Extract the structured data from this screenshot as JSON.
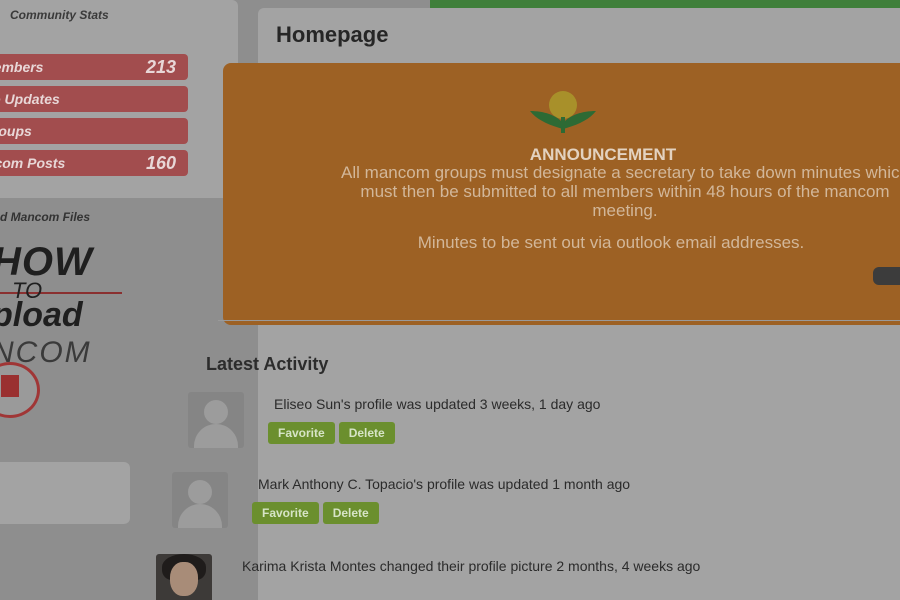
{
  "community_stats": {
    "title": "Community Stats",
    "items": [
      {
        "label": "Members",
        "value": "213"
      },
      {
        "label": "No Updates",
        "value": ""
      },
      {
        "label": "Groups",
        "value": ""
      },
      {
        "label": "mcom Posts",
        "value": "160"
      }
    ]
  },
  "files": {
    "title": "d Mancom Files",
    "howto_line1": "HOW",
    "howto_line2": "TO",
    "howto_line3": "pload",
    "howto_line4": "NCOM"
  },
  "page": {
    "title": "Homepage"
  },
  "announcement": {
    "heading": "ANNOUNCEMENT",
    "body": "All mancom groups must designate a secretary to take down minutes which must then be submitted to all members within 48 hours of the mancom meeting.",
    "note": "Minutes to be sent out via outlook email addresses."
  },
  "activity": {
    "title": "Latest Activity",
    "items": [
      {
        "text": "Eliseo Sun's profile was updated 3 weeks, 1 day ago",
        "favorite": "Favorite",
        "delete": "Delete"
      },
      {
        "text": "Mark Anthony C. Topacio's profile was updated 1 month ago",
        "favorite": "Favorite",
        "delete": "Delete"
      },
      {
        "text": "Karima Krista Montes changed their profile picture 2 months, 4 weeks ago",
        "favorite": "",
        "delete": ""
      }
    ]
  },
  "colors": {
    "stat_red": "#a24d4e",
    "announcement_orange": "#9d6124",
    "button_green": "#6b8f2e"
  }
}
